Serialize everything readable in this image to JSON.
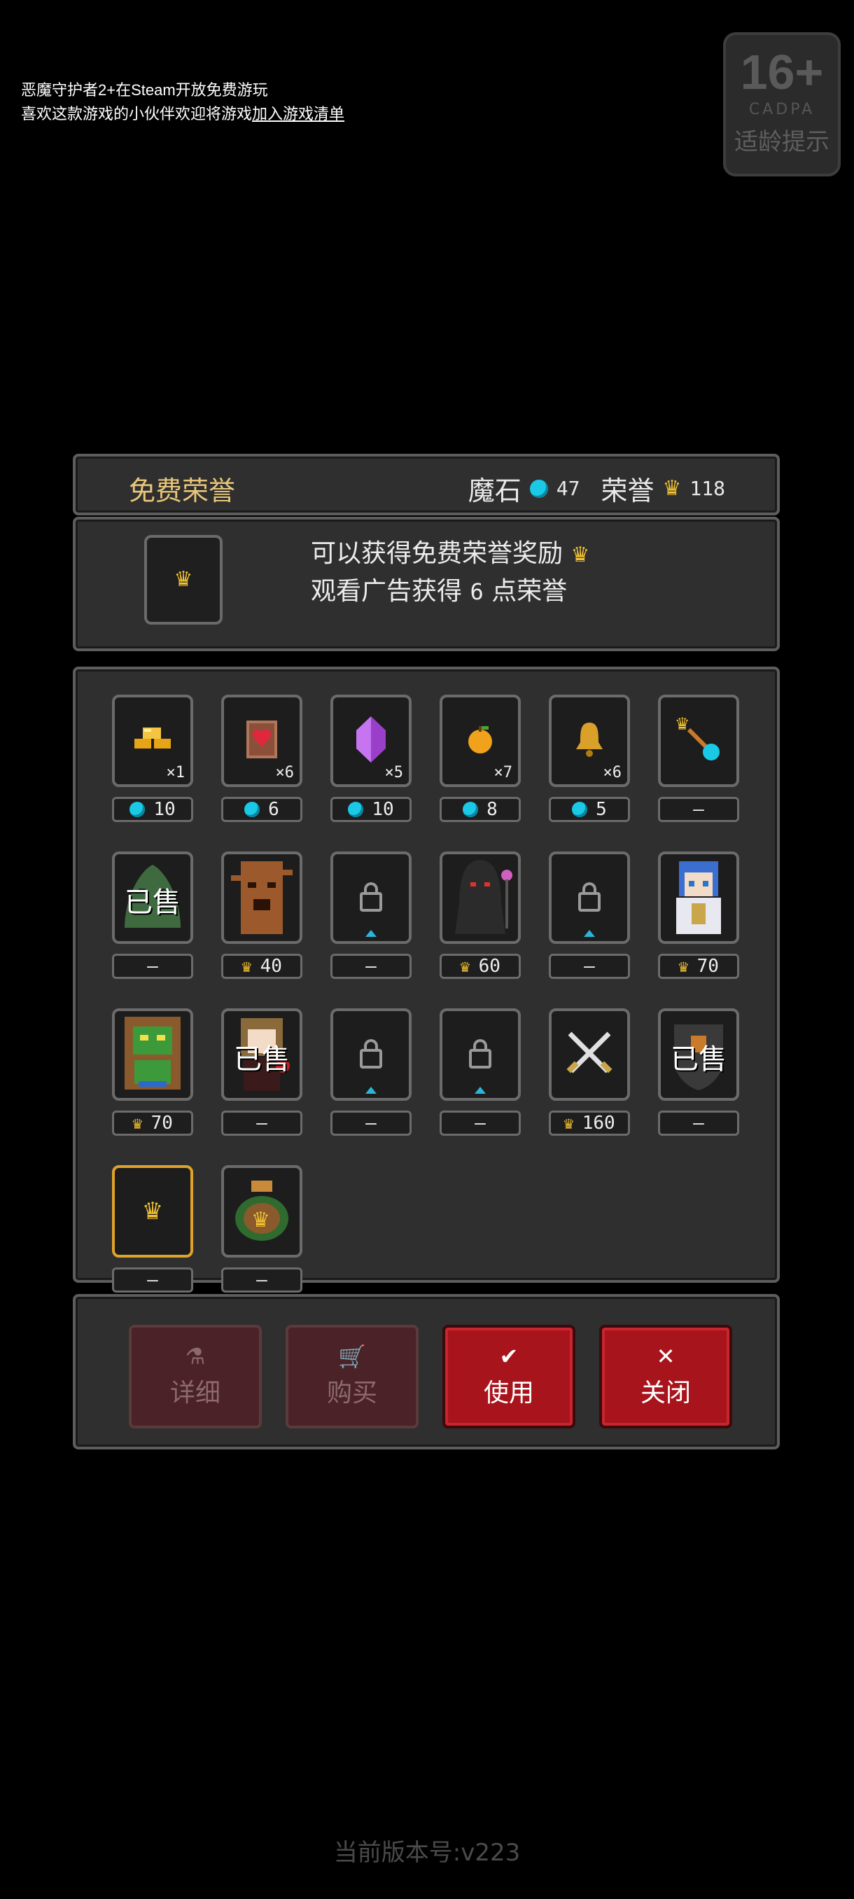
{
  "notice": {
    "line1": "恶魔守护者2+在Steam开放免费游玩",
    "line2_prefix": "喜欢这款游戏的小伙伴欢迎将游戏",
    "line2_link": "加入游戏清单"
  },
  "age_badge": {
    "age": "16+",
    "org": "CADPA",
    "label": "适龄提示"
  },
  "header": {
    "title": "免费荣誉",
    "magic_stone_label": "魔石",
    "magic_stone_value": "47",
    "honor_label": "荣誉",
    "honor_value": "118"
  },
  "info": {
    "line1": "可以获得免费荣誉奖励",
    "line2_prefix": "观看广告获得",
    "line2_value": "6",
    "line2_suffix": "点荣誉"
  },
  "items": [
    {
      "icon": "gold-bars-icon",
      "count": "×1",
      "price": "10",
      "currency": "gem"
    },
    {
      "icon": "heart-scroll-icon",
      "count": "×6",
      "price": "6",
      "currency": "gem"
    },
    {
      "icon": "purple-crystal-icon",
      "count": "×5",
      "price": "10",
      "currency": "gem"
    },
    {
      "icon": "golden-apple-icon",
      "count": "×7",
      "price": "8",
      "currency": "gem"
    },
    {
      "icon": "golden-bell-icon",
      "count": "×6",
      "price": "5",
      "currency": "gem"
    },
    {
      "icon": "crown-to-gem-icon",
      "count": "",
      "price": "—",
      "currency": "none"
    },
    {
      "icon": "green-slime-icon",
      "sold": "已售",
      "price": "—",
      "currency": "none"
    },
    {
      "icon": "tree-monster-icon",
      "price": "40",
      "currency": "crown"
    },
    {
      "icon": "lock-icon",
      "locked": true,
      "price": "—",
      "currency": "none"
    },
    {
      "icon": "dark-reaper-icon",
      "price": "60",
      "currency": "crown"
    },
    {
      "icon": "lock-icon",
      "locked": true,
      "price": "—",
      "currency": "none"
    },
    {
      "icon": "blue-hair-knight-icon",
      "price": "70",
      "currency": "crown"
    },
    {
      "icon": "green-goblin-icon",
      "price": "70",
      "currency": "crown"
    },
    {
      "icon": "brown-hair-girl-icon",
      "sold": "已售",
      "price": "—",
      "currency": "none"
    },
    {
      "icon": "lock-icon",
      "locked": true,
      "price": "—",
      "currency": "none"
    },
    {
      "icon": "lock-icon",
      "locked": true,
      "price": "—",
      "currency": "none"
    },
    {
      "icon": "crossed-swords-icon",
      "price": "160",
      "currency": "crown"
    },
    {
      "icon": "dark-shield-icon",
      "sold": "已售",
      "price": "—",
      "currency": "none"
    },
    {
      "icon": "crown-icon",
      "selected": true,
      "price": "—",
      "currency": "none"
    },
    {
      "icon": "crown-bag-icon",
      "price": "—",
      "currency": "none"
    }
  ],
  "buttons": {
    "details": "详细",
    "buy": "购买",
    "use": "使用",
    "close": "关闭"
  },
  "version": "当前版本号:v223",
  "colors": {
    "gem": "#19c9e6",
    "crown": "#f1c232",
    "accent_red": "#a8141c",
    "panel": "#2f2f2f"
  }
}
